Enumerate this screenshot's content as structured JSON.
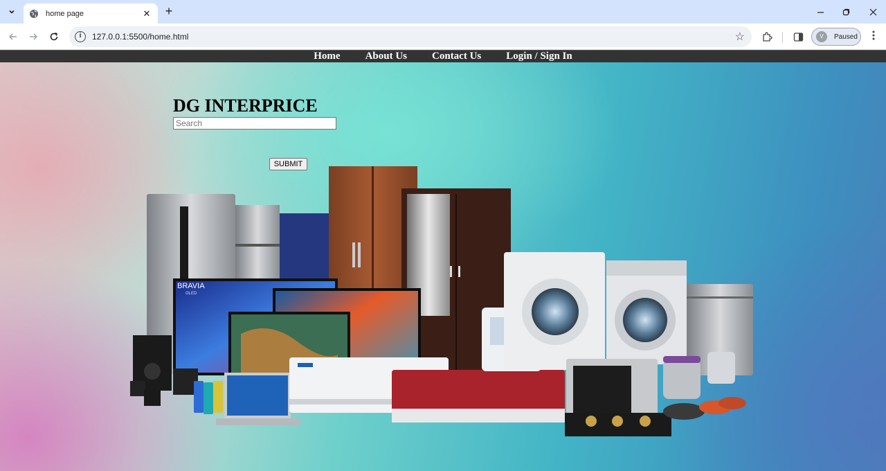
{
  "browser": {
    "tab_title": "home page",
    "url": "127.0.0.1:5500/home.html",
    "profile_label": "Paused",
    "profile_initial": "V"
  },
  "nav": {
    "items": [
      {
        "label": "Home"
      },
      {
        "label": "About Us"
      },
      {
        "label": "Contact Us"
      },
      {
        "label": "Login / Sign In"
      }
    ]
  },
  "page": {
    "brand": "DG INTERPRICE",
    "search_placeholder": "Search",
    "submit_label": "SUBMIT",
    "hero_labels": {
      "tv_brand": "BRAVIA",
      "tv_sub": "OLED"
    }
  },
  "colors": {
    "nav_bg": "#333333",
    "nav_text": "#ffffff",
    "tab_strip": "#d3e3fd",
    "gradient_teal": "#6fd0cb",
    "gradient_blue": "#3d8fbf",
    "gradient_pink": "#d678be"
  }
}
